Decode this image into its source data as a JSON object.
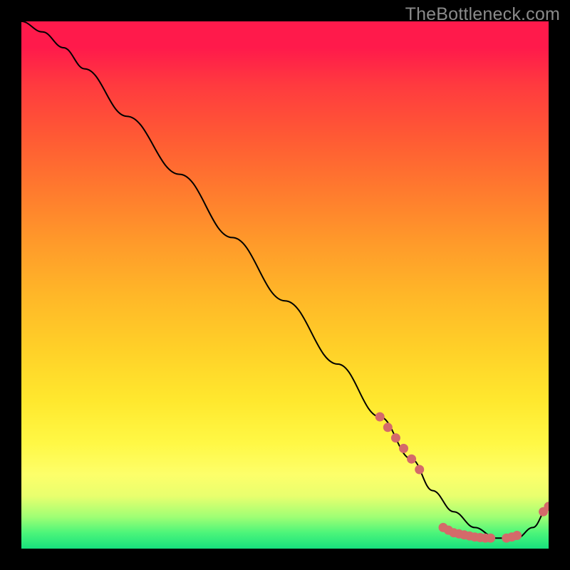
{
  "watermark": "TheBottleneck.com",
  "chart_data": {
    "type": "line",
    "title": "",
    "xlabel": "",
    "ylabel": "",
    "xlim": [
      0,
      100
    ],
    "ylim": [
      0,
      100
    ],
    "grid": false,
    "legend": false,
    "series": [
      {
        "name": "curve",
        "x": [
          0,
          4,
          8,
          12,
          20,
          30,
          40,
          50,
          60,
          68,
          74,
          78,
          82,
          86,
          90,
          94,
          97,
          100
        ],
        "y": [
          100,
          98,
          95,
          91,
          82,
          71,
          59,
          47,
          35,
          25,
          17,
          11,
          7,
          4,
          2,
          2,
          4,
          8
        ]
      }
    ],
    "markers": [
      {
        "x": 68.0,
        "y": 25.0
      },
      {
        "x": 69.5,
        "y": 23.0
      },
      {
        "x": 71.0,
        "y": 21.0
      },
      {
        "x": 72.5,
        "y": 19.0
      },
      {
        "x": 74.0,
        "y": 17.0
      },
      {
        "x": 75.5,
        "y": 15.0
      },
      {
        "x": 80.0,
        "y": 4.0
      },
      {
        "x": 81.0,
        "y": 3.5
      },
      {
        "x": 82.0,
        "y": 3.0
      },
      {
        "x": 83.0,
        "y": 2.8
      },
      {
        "x": 84.0,
        "y": 2.6
      },
      {
        "x": 85.0,
        "y": 2.4
      },
      {
        "x": 86.0,
        "y": 2.2
      },
      {
        "x": 87.0,
        "y": 2.1
      },
      {
        "x": 88.0,
        "y": 2.0
      },
      {
        "x": 89.0,
        "y": 2.0
      },
      {
        "x": 92.0,
        "y": 2.0
      },
      {
        "x": 93.0,
        "y": 2.2
      },
      {
        "x": 94.0,
        "y": 2.5
      },
      {
        "x": 99.0,
        "y": 7.0
      },
      {
        "x": 100.0,
        "y": 8.0
      }
    ],
    "colors": {
      "curve": "#000000",
      "marker": "#d46a6a",
      "gradient_top": "#ff1a4b",
      "gradient_bottom": "#17e07d"
    }
  }
}
